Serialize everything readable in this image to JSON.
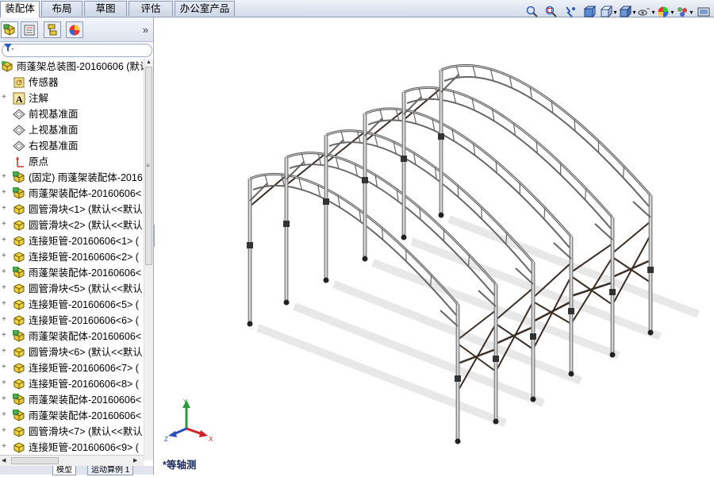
{
  "command_tabs": [
    "装配体",
    "布局",
    "草图",
    "评估",
    "办公室产品"
  ],
  "active_tab_index": 0,
  "view_toolbar_icons": [
    "zoom-to-fit-icon",
    "zoom-to-area-icon",
    "previous-view-icon",
    "section-view-icon",
    "view-orientation-icon",
    "display-style-icon",
    "hide-show-items-icon",
    "edit-appearance-icon",
    "apply-scene-icon",
    "view-settings-icon"
  ],
  "panel_tabs": [
    "featuremanager-icon",
    "propertymanager-icon",
    "configurationmanager-icon",
    "display-manager-icon"
  ],
  "collapse_label": "»",
  "tree": {
    "root": "雨蓬架总装图-20160606  (默认",
    "items": [
      {
        "label": "传感器",
        "icon": "sensor-icon",
        "expand": false
      },
      {
        "label": "注解",
        "icon": "annotation-icon",
        "expand": true
      },
      {
        "label": "前视基准面",
        "icon": "plane-icon",
        "expand": false
      },
      {
        "label": "上视基准面",
        "icon": "plane-icon",
        "expand": false
      },
      {
        "label": "右视基准面",
        "icon": "plane-icon",
        "expand": false
      },
      {
        "label": "原点",
        "icon": "origin-icon",
        "expand": false
      },
      {
        "label": "(固定) 雨蓬架装配体-2016",
        "icon": "subassembly-icon",
        "expand": true
      },
      {
        "label": "雨蓬架装配体-20160606<",
        "icon": "subassembly-icon",
        "expand": true
      },
      {
        "label": "圆管滑块<1> (默认<<默认",
        "icon": "part-icon",
        "expand": true
      },
      {
        "label": "圆管滑块<2> (默认<<默认",
        "icon": "part-icon",
        "expand": true
      },
      {
        "label": "连接矩管-20160606<1> (",
        "icon": "part-icon",
        "expand": true
      },
      {
        "label": "连接矩管-20160606<2> (",
        "icon": "part-icon",
        "expand": true
      },
      {
        "label": "雨蓬架装配体-20160606<",
        "icon": "subassembly-icon",
        "expand": true
      },
      {
        "label": "圆管滑块<5> (默认<<默认",
        "icon": "part-icon",
        "expand": true
      },
      {
        "label": "连接矩管-20160606<5> (",
        "icon": "part-icon",
        "expand": true
      },
      {
        "label": "连接矩管-20160606<6> (",
        "icon": "part-icon",
        "expand": true
      },
      {
        "label": "雨蓬架装配体-20160606<",
        "icon": "subassembly-icon",
        "expand": true
      },
      {
        "label": "圆管滑块<6> (默认<<默认",
        "icon": "part-icon",
        "expand": true
      },
      {
        "label": "连接矩管-20160606<7> (",
        "icon": "part-icon",
        "expand": true
      },
      {
        "label": "连接矩管-20160606<8> (",
        "icon": "part-icon",
        "expand": true
      },
      {
        "label": "雨蓬架装配体-20160606<",
        "icon": "subassembly-icon",
        "expand": true
      },
      {
        "label": "雨蓬架装配体-20160606<",
        "icon": "subassembly-icon",
        "expand": true
      },
      {
        "label": "圆管滑块<7> (默认<<默认",
        "icon": "part-icon",
        "expand": true
      },
      {
        "label": "连接矩管-20160606<9> (",
        "icon": "part-icon",
        "expand": true
      }
    ]
  },
  "bottom_tabs": [
    "模型",
    "运动算例 1"
  ],
  "view_label": "*等轴测",
  "triad": {
    "x": "X",
    "y": "Y",
    "z": "Z"
  },
  "colors": {
    "accent": "#2b5fb3",
    "frame": "#8c8c8c",
    "brace": "#3a2e24"
  }
}
